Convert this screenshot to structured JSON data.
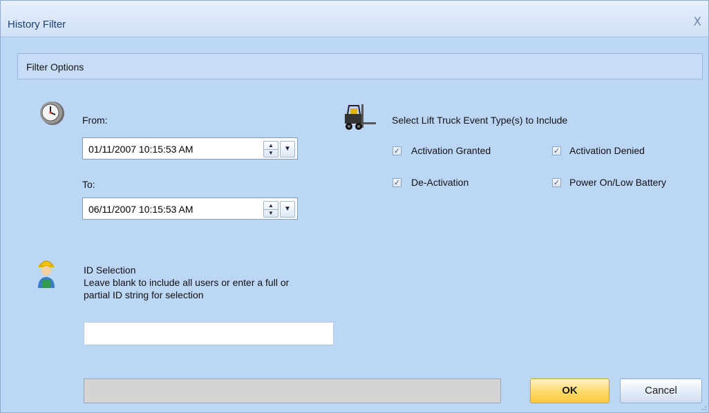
{
  "window": {
    "title": "History Filter",
    "close_glyph": "X"
  },
  "group": {
    "label": "Filter Options"
  },
  "icons": {
    "clock": "clock-icon",
    "forklift": "forklift-icon",
    "user": "user-icon"
  },
  "from": {
    "label": "From:",
    "value": "01/11/2007 10:15:53 AM"
  },
  "to": {
    "label": "To:",
    "value": "06/11/2007 10:15:53 AM"
  },
  "events": {
    "heading": "Select Lift Truck Event Type(s) to Include",
    "items": [
      {
        "label": "Activation Granted",
        "checked": true
      },
      {
        "label": "Activation Denied",
        "checked": true
      },
      {
        "label": "De-Activation",
        "checked": true
      },
      {
        "label": "Power On/Low Battery",
        "checked": true
      }
    ]
  },
  "id_selection": {
    "title": "ID Selection",
    "line1": "Leave blank to include all users or enter a full or",
    "line2": "partial ID string for selection",
    "value": ""
  },
  "buttons": {
    "ok": "OK",
    "cancel": "Cancel"
  },
  "colors": {
    "dialog_bg": "#bcd6f6",
    "ok_accent": "#ffd86a"
  }
}
